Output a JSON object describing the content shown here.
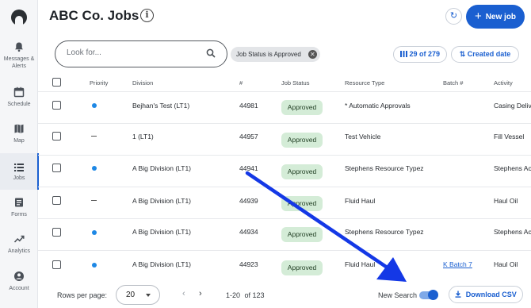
{
  "app": {
    "title": "ABC Co. Jobs"
  },
  "sidebar": {
    "logo": "app-logo",
    "items": [
      {
        "label": "Messages & Alerts",
        "icon": "bell-icon"
      },
      {
        "label": "Schedule",
        "icon": "calendar-icon"
      },
      {
        "label": "Map",
        "icon": "map-icon"
      },
      {
        "label": "Jobs",
        "icon": "list-icon",
        "active": true
      },
      {
        "label": "Forms",
        "icon": "forms-icon"
      },
      {
        "label": "Analytics",
        "icon": "trend-icon"
      },
      {
        "label": "Account",
        "icon": "account-icon"
      }
    ]
  },
  "header": {
    "info_icon": "i",
    "refresh_icon": "↻",
    "new_job_label": "New job"
  },
  "search": {
    "placeholder": "Look for...",
    "value": "",
    "chip_label": "Job Status is Approved",
    "count_label": "29 of 279",
    "sort_label": "Created date"
  },
  "table": {
    "columns": [
      "Priority",
      "Division",
      "#",
      "Job Status",
      "Resource Type",
      "Batch #",
      "Activity"
    ],
    "rows": [
      {
        "priority": "dot",
        "division": "Bejhan's Test (LT1)",
        "number": "44981",
        "status": "Approved",
        "resource_type": "* Automatic Approvals",
        "batch": "",
        "activity": "Casing Deliv"
      },
      {
        "priority": "dash",
        "division": "1 (LT1)",
        "number": "44957",
        "status": "Approved",
        "resource_type": "Test Vehicle",
        "batch": "",
        "activity": "Fill Vessel"
      },
      {
        "priority": "dot",
        "division": "A Big Division (LT1)",
        "number": "44941",
        "status": "Approved",
        "resource_type": "Stephens Resource Typez",
        "batch": "",
        "activity": "Stephens Act"
      },
      {
        "priority": "dash",
        "division": "A Big Division (LT1)",
        "number": "44939",
        "status": "Approved",
        "resource_type": "Fluid Haul",
        "batch": "",
        "activity": "Haul Oil"
      },
      {
        "priority": "dot",
        "division": "A Big Division (LT1)",
        "number": "44934",
        "status": "Approved",
        "resource_type": "Stephens Resource Typez",
        "batch": "",
        "activity": "Stephens Act"
      },
      {
        "priority": "dot",
        "division": "A Big Division (LT1)",
        "number": "44923",
        "status": "Approved",
        "resource_type": "Fluid Haul",
        "batch": "K Batch 7",
        "activity": "Haul Oil"
      }
    ]
  },
  "footer": {
    "rows_per_page_label": "Rows per page:",
    "rows_per_page_value": "20",
    "page_range": "1-20",
    "total_label": "of 123",
    "new_search_label": "New Search",
    "new_search_enabled": true,
    "download_label": "Download CSV"
  },
  "colors": {
    "accent": "#1a5fd0",
    "status_bg": "#d4ecd7",
    "priority_dot": "#1e88e5",
    "annotation_arrow": "#1438e6"
  }
}
